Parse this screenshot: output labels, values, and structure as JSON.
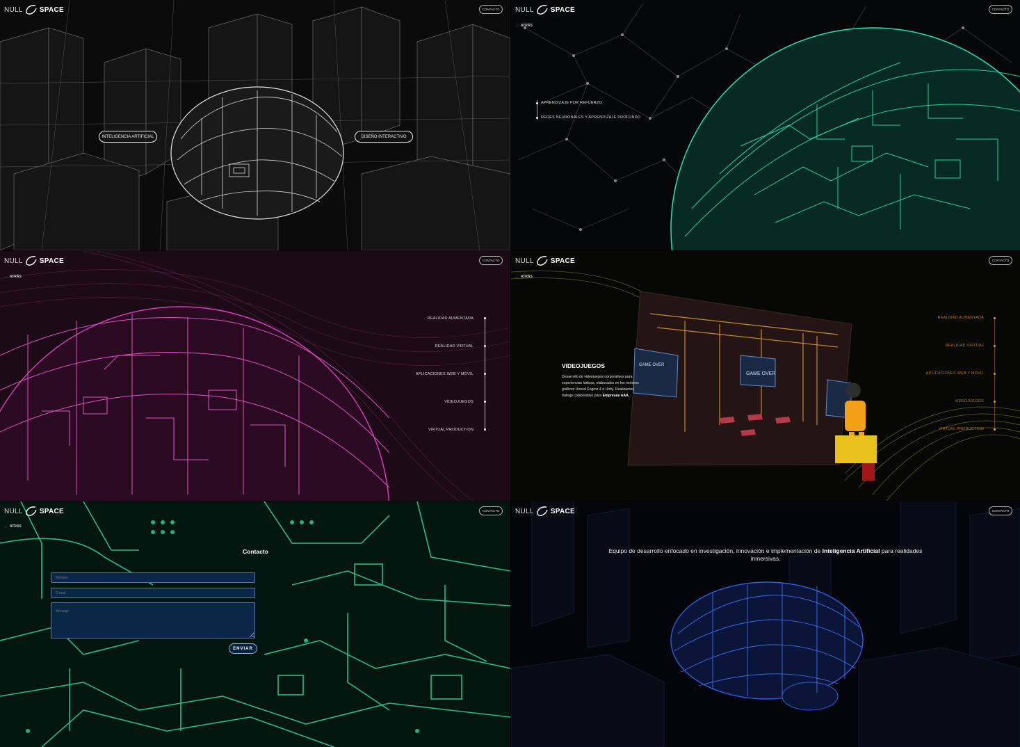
{
  "brand": {
    "left": "NULL",
    "right": "SPACE"
  },
  "contact_label": "CONTACTO",
  "back_label": "ATRÁS",
  "home": {
    "pills": [
      "INTELIGENCIA ARTIFICIAL",
      "DISEÑO INTERACTIVO"
    ]
  },
  "ai_menu": {
    "items": [
      "APRENDIZAJE POR REFUERZO",
      "REDES NEURONALES Y APRENDIZAJE PROFUNDO"
    ]
  },
  "design_menu": {
    "items": [
      "REALIDAD AUMENTADA",
      "REALIDAD VIRTUAL",
      "APLICACIONES WEB Y MÓVIL",
      "VIDEOJUEGOS",
      "VIRTUAL PRODUCTION"
    ]
  },
  "videogames": {
    "title": "VIDEOJUEGOS",
    "body": "Desarrollo de videojuegos corporativos para experiencias lúdicas, elaborados en los motores gráficos Unreal Engine 4 o Unity. Realizamos trabajo colaborativo para",
    "body_strong": "Empresas AAA.",
    "screen_texts": [
      "GAME OVER",
      "GAME OVER",
      "GAME OVER"
    ]
  },
  "contact_form": {
    "title": "Contacto",
    "name_placeholder": "Nombre",
    "email_placeholder": "E-mail",
    "message_placeholder": "Mensaje",
    "submit_label": "ENVIAR"
  },
  "about": {
    "text_before": "Equipo de desarrollo enfocado en investigación, innovación e implementación de",
    "text_strong": "Inteligencia Artificial",
    "text_after": "para realidades inmersivas."
  },
  "colors": {
    "home_accent": "#ffffff",
    "ai_accent": "#22e3b5",
    "design_accent": "#d63bb8",
    "videogames_accent": "#f2a018",
    "contact_accent": "#27d9a6",
    "about_accent": "#2f5fe0"
  }
}
